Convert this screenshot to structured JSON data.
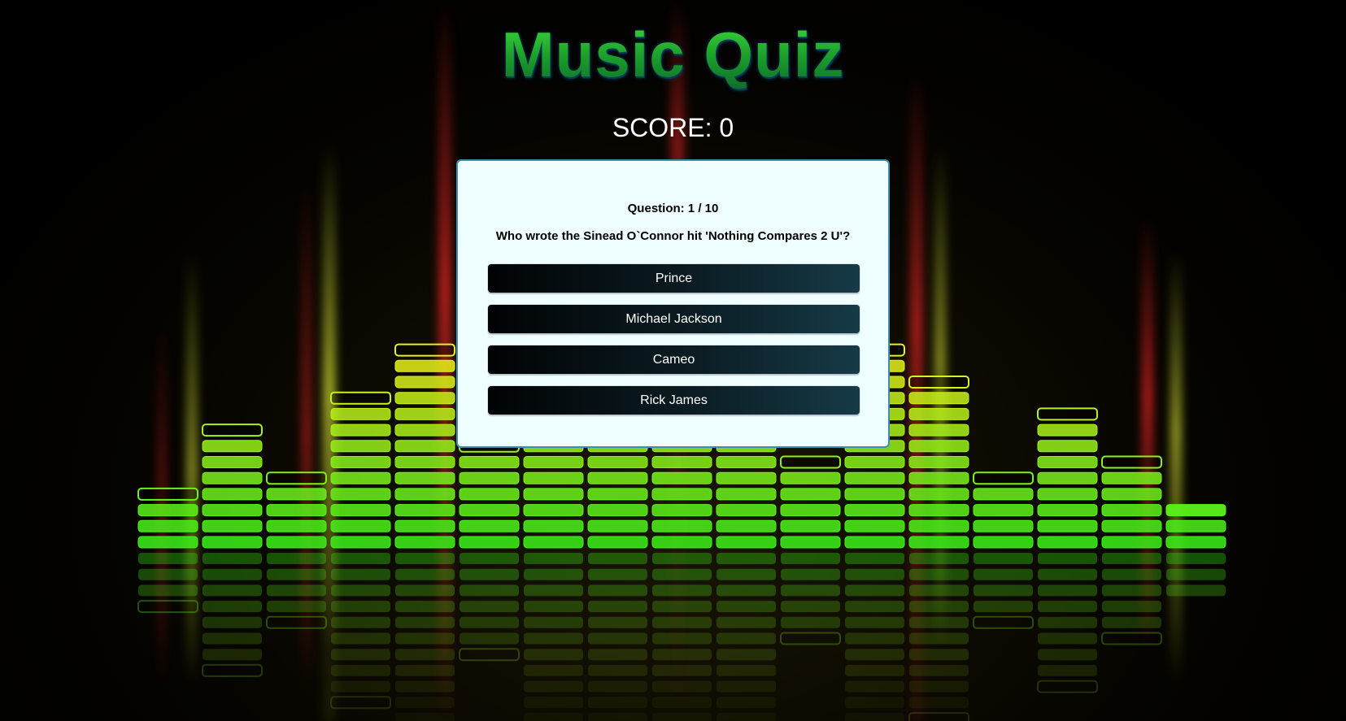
{
  "header": {
    "title": "Music Quiz",
    "score_label": "SCORE: 0"
  },
  "quiz": {
    "question_counter": "Question: 1 / 10",
    "question": "Who wrote the Sinead O`Connor hit 'Nothing Compares 2 U'?",
    "answers": [
      {
        "label": "Prince"
      },
      {
        "label": "Michael Jackson"
      },
      {
        "label": "Cameo"
      },
      {
        "label": "Rick James"
      }
    ]
  },
  "colors": {
    "title_green": "#1fae2c",
    "card_background": "#effefe",
    "card_border": "#3b8fb0",
    "answer_dark": "#010304",
    "answer_teal": "#163a47",
    "eq_green": "#3df21a",
    "eq_yellow": "#e6f21a",
    "streak_red": "#ff2a2a",
    "streak_yellow": "#f0ff3a"
  },
  "background": {
    "description_icon": "equalizer-background",
    "equalizer_levels": [
      1,
      5,
      2,
      7,
      10,
      4,
      9,
      9,
      9,
      9,
      3,
      10,
      8,
      2,
      6,
      3,
      0
    ]
  }
}
